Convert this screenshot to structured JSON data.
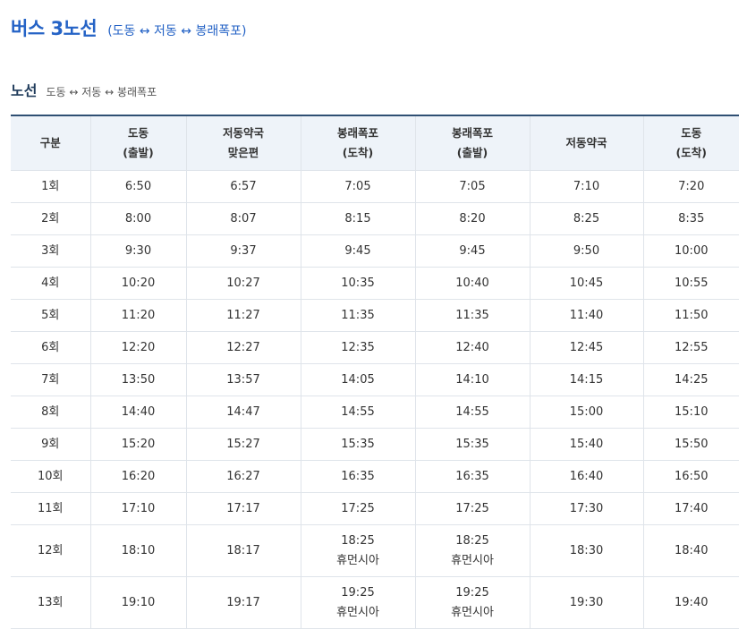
{
  "title": "버스 3노선",
  "title_route": "(도동 ↔ 저동 ↔ 봉래폭포)",
  "section": {
    "title": "노선",
    "route": "도동 ↔ 저동 ↔ 봉래폭포"
  },
  "table": {
    "headers": [
      [
        "구분"
      ],
      [
        "도동",
        "(출발)"
      ],
      [
        "저동약국",
        "맞은편"
      ],
      [
        "봉래폭포",
        "(도착)"
      ],
      [
        "봉래폭포",
        "(출발)"
      ],
      [
        "저동약국"
      ],
      [
        "도동",
        "(도착)"
      ]
    ],
    "rows": [
      [
        [
          "1회"
        ],
        [
          "6:50"
        ],
        [
          "6:57"
        ],
        [
          "7:05"
        ],
        [
          "7:05"
        ],
        [
          "7:10"
        ],
        [
          "7:20"
        ]
      ],
      [
        [
          "2회"
        ],
        [
          "8:00"
        ],
        [
          "8:07"
        ],
        [
          "8:15"
        ],
        [
          "8:20"
        ],
        [
          "8:25"
        ],
        [
          "8:35"
        ]
      ],
      [
        [
          "3회"
        ],
        [
          "9:30"
        ],
        [
          "9:37"
        ],
        [
          "9:45"
        ],
        [
          "9:45"
        ],
        [
          "9:50"
        ],
        [
          "10:00"
        ]
      ],
      [
        [
          "4회"
        ],
        [
          "10:20"
        ],
        [
          "10:27"
        ],
        [
          "10:35"
        ],
        [
          "10:40"
        ],
        [
          "10:45"
        ],
        [
          "10:55"
        ]
      ],
      [
        [
          "5회"
        ],
        [
          "11:20"
        ],
        [
          "11:27"
        ],
        [
          "11:35"
        ],
        [
          "11:35"
        ],
        [
          "11:40"
        ],
        [
          "11:50"
        ]
      ],
      [
        [
          "6회"
        ],
        [
          "12:20"
        ],
        [
          "12:27"
        ],
        [
          "12:35"
        ],
        [
          "12:40"
        ],
        [
          "12:45"
        ],
        [
          "12:55"
        ]
      ],
      [
        [
          "7회"
        ],
        [
          "13:50"
        ],
        [
          "13:57"
        ],
        [
          "14:05"
        ],
        [
          "14:10"
        ],
        [
          "14:15"
        ],
        [
          "14:25"
        ]
      ],
      [
        [
          "8회"
        ],
        [
          "14:40"
        ],
        [
          "14:47"
        ],
        [
          "14:55"
        ],
        [
          "14:55"
        ],
        [
          "15:00"
        ],
        [
          "15:10"
        ]
      ],
      [
        [
          "9회"
        ],
        [
          "15:20"
        ],
        [
          "15:27"
        ],
        [
          "15:35"
        ],
        [
          "15:35"
        ],
        [
          "15:40"
        ],
        [
          "15:50"
        ]
      ],
      [
        [
          "10회"
        ],
        [
          "16:20"
        ],
        [
          "16:27"
        ],
        [
          "16:35"
        ],
        [
          "16:35"
        ],
        [
          "16:40"
        ],
        [
          "16:50"
        ]
      ],
      [
        [
          "11회"
        ],
        [
          "17:10"
        ],
        [
          "17:17"
        ],
        [
          "17:25"
        ],
        [
          "17:25"
        ],
        [
          "17:30"
        ],
        [
          "17:40"
        ]
      ],
      [
        [
          "12회"
        ],
        [
          "18:10"
        ],
        [
          "18:17"
        ],
        [
          "18:25",
          "휴먼시아"
        ],
        [
          "18:25",
          "휴먼시아"
        ],
        [
          "18:30"
        ],
        [
          "18:40"
        ]
      ],
      [
        [
          "13회"
        ],
        [
          "19:10"
        ],
        [
          "19:17"
        ],
        [
          "19:25",
          "휴먼시아"
        ],
        [
          "19:25",
          "휴먼시아"
        ],
        [
          "19:30"
        ],
        [
          "19:40"
        ]
      ]
    ]
  }
}
